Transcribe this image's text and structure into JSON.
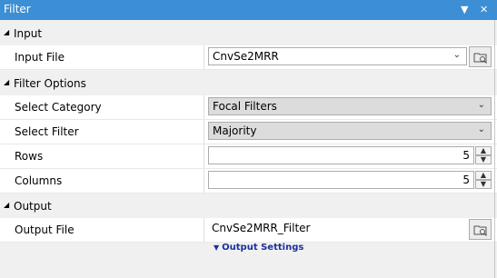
{
  "window": {
    "title": "Filter",
    "menu_icon": "▼",
    "close_icon": "✕"
  },
  "sections": {
    "input": "Input",
    "filter_options": "Filter Options",
    "output": "Output"
  },
  "rows": {
    "input_file": {
      "label": "Input File",
      "value": "CnvSe2MRR"
    },
    "select_category": {
      "label": "Select Category",
      "value": "Focal Filters"
    },
    "select_filter": {
      "label": "Select Filter",
      "value": "Majority"
    },
    "rows": {
      "label": "Rows",
      "value": "5"
    },
    "columns": {
      "label": "Columns",
      "value": "5"
    },
    "output_file": {
      "label": "Output File",
      "value": "CnvSe2MRR_Filter"
    }
  },
  "output_settings": {
    "label": "Output Settings"
  },
  "colors": {
    "titlebar": "#3c8ed5",
    "link": "#1b2f9c"
  }
}
